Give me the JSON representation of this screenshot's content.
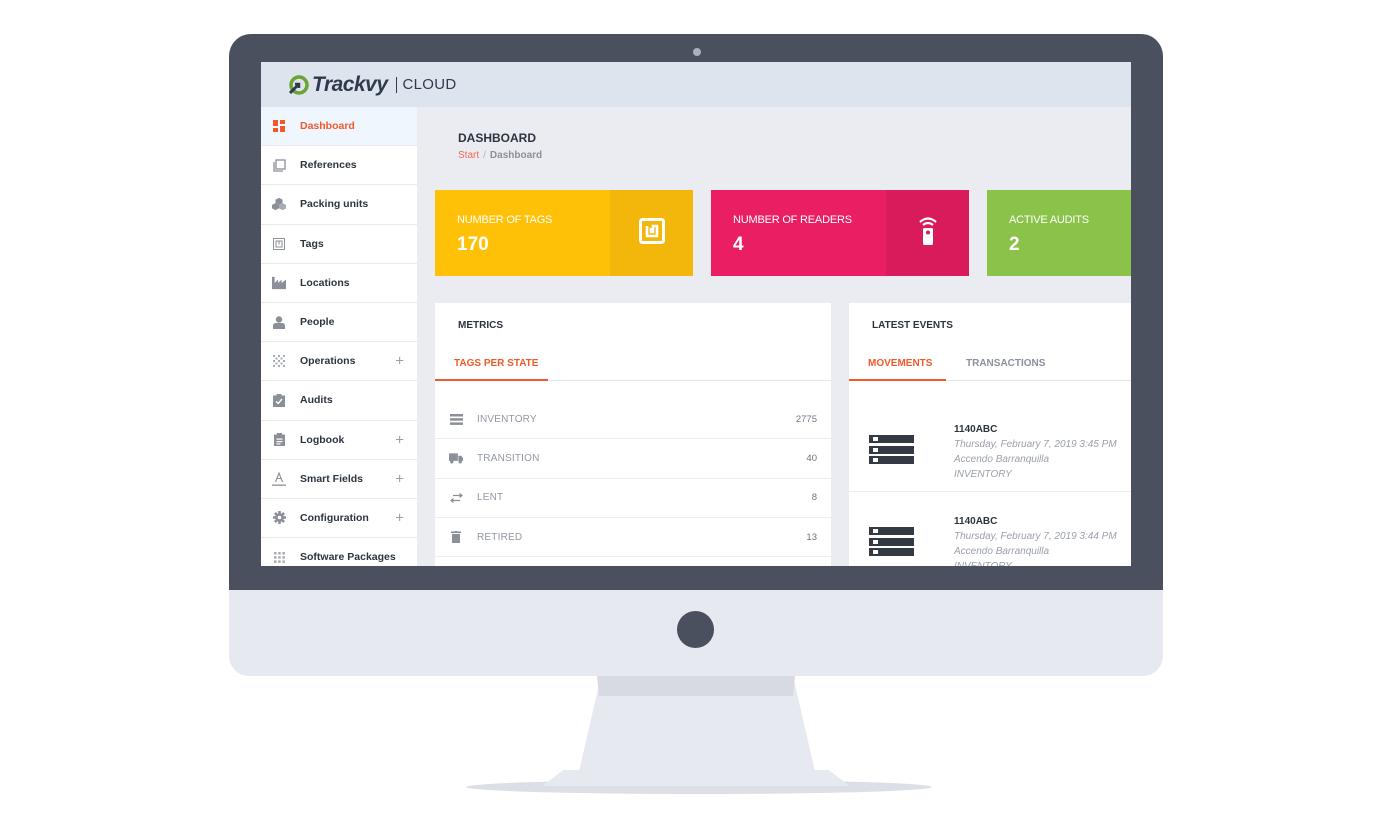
{
  "app": {
    "logo_name": "Trackvy",
    "logo_suffix": "CLOUD"
  },
  "sidebar": {
    "items": [
      {
        "label": "Dashboard",
        "icon": "dashboard-icon",
        "active": true,
        "expandable": false
      },
      {
        "label": "References",
        "icon": "references-icon",
        "active": false,
        "expandable": false
      },
      {
        "label": "Packing units",
        "icon": "boxes-icon",
        "active": false,
        "expandable": false
      },
      {
        "label": "Tags",
        "icon": "tag-icon",
        "active": false,
        "expandable": false
      },
      {
        "label": "Locations",
        "icon": "factory-icon",
        "active": false,
        "expandable": false
      },
      {
        "label": "People",
        "icon": "person-icon",
        "active": false,
        "expandable": false
      },
      {
        "label": "Operations",
        "icon": "operations-icon",
        "active": false,
        "expandable": true
      },
      {
        "label": "Audits",
        "icon": "clipboard-check-icon",
        "active": false,
        "expandable": false
      },
      {
        "label": "Logbook",
        "icon": "clipboard-icon",
        "active": false,
        "expandable": true
      },
      {
        "label": "Smart Fields",
        "icon": "text-field-icon",
        "active": false,
        "expandable": true
      },
      {
        "label": "Configuration",
        "icon": "gear-icon",
        "active": false,
        "expandable": true
      },
      {
        "label": "Software Packages",
        "icon": "grid-icon",
        "active": false,
        "expandable": false
      }
    ],
    "expand_symbol": "+"
  },
  "header": {
    "title": "DASHBOARD",
    "breadcrumb": {
      "start": "Start",
      "separator": "/",
      "current": "Dashboard"
    }
  },
  "stats": [
    {
      "label": "NUMBER OF TAGS",
      "value": "170",
      "icon": "rfid-tag-icon",
      "color": "#ffc107"
    },
    {
      "label": "NUMBER OF READERS",
      "value": "4",
      "icon": "reader-icon",
      "color": "#e91e63"
    },
    {
      "label": "ACTIVE AUDITS",
      "value": "2",
      "icon": "",
      "color": "#8bc34a"
    }
  ],
  "metrics": {
    "title": "METRICS",
    "tabs": [
      {
        "label": "TAGS PER STATE",
        "active": true
      }
    ],
    "rows": [
      {
        "label": "INVENTORY",
        "value": "2775",
        "icon": "list-icon"
      },
      {
        "label": "TRANSITION",
        "value": "40",
        "icon": "truck-icon"
      },
      {
        "label": "LENT",
        "value": "8",
        "icon": "exchange-icon"
      },
      {
        "label": "RETIRED",
        "value": "13",
        "icon": "trash-icon"
      }
    ]
  },
  "events": {
    "title": "LATEST EVENTS",
    "tabs": [
      {
        "label": "MOVEMENTS",
        "active": true
      },
      {
        "label": "TRANSACTIONS",
        "active": false
      }
    ],
    "items": [
      {
        "id": "1140ABC",
        "datetime": "Thursday, February 7, 2019 3:45 PM",
        "location": "Accendo Barranquilla",
        "state": "INVENTORY"
      },
      {
        "id": "1140ABC",
        "datetime": "Thursday, February 7, 2019 3:44 PM",
        "location": "Accendo Barranquilla",
        "state": "INVENTORY"
      }
    ]
  },
  "colors": {
    "accent": "#f2592a",
    "bezel": "#4a505e",
    "topbar": "#dde4ee"
  }
}
